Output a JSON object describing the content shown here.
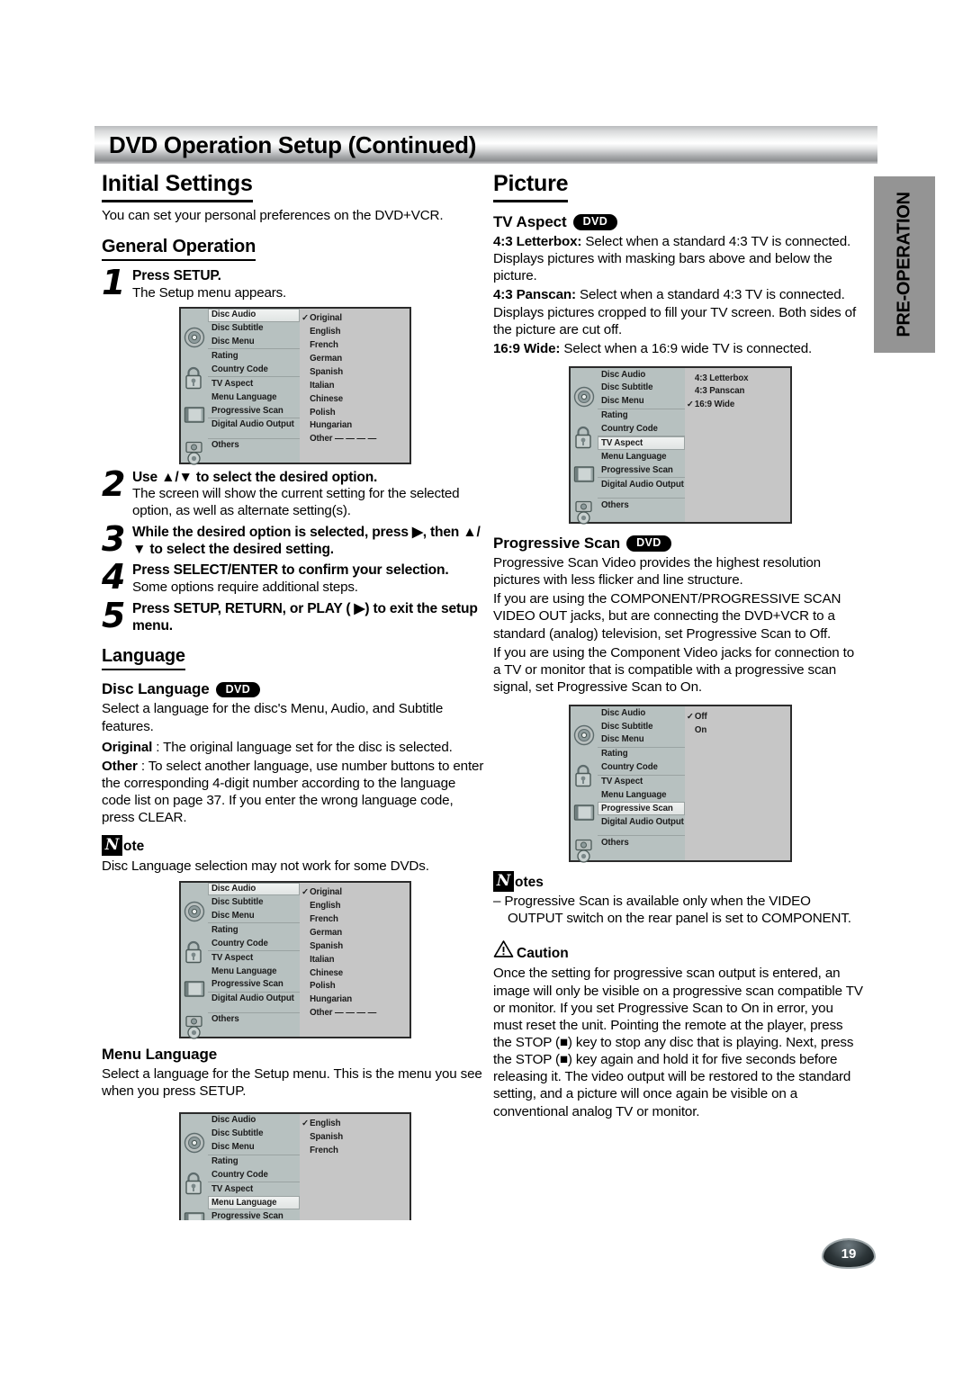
{
  "header": {
    "title": "DVD Operation Setup (Continued)"
  },
  "side_tab": {
    "label": "PRE-OPERATION"
  },
  "page_number": "19",
  "left_column": {
    "initial_settings": {
      "heading": "Initial Settings",
      "intro": "You can set your personal preferences on the DVD+VCR."
    },
    "general_operation": {
      "heading": "General Operation",
      "steps": [
        {
          "num": "1",
          "bold": "Press SETUP.",
          "text": "The Setup menu appears."
        },
        {
          "num": "2",
          "bold": "Use ▲/▼ to select the desired option.",
          "text": "The screen will show the current setting for the selected option, as well as alternate setting(s)."
        },
        {
          "num": "3",
          "bold": "While the desired option is selected, press ▶, then ▲/▼ to select the desired setting.",
          "text": ""
        },
        {
          "num": "4",
          "bold": "Press SELECT/ENTER to confirm your selection.",
          "text": "Some options require additional steps."
        },
        {
          "num": "5",
          "bold": "Press SETUP, RETURN, or PLAY ( ▶) to exit the setup menu.",
          "text": ""
        }
      ]
    },
    "language": {
      "heading": "Language",
      "disc_language": {
        "title": "Disc Language",
        "badge": "DVD",
        "para1": "Select a language for the disc's Menu, Audio, and Subtitle features.",
        "original_label": "Original",
        "original_text": " : The original language set for the disc is selected.",
        "other_label": "Other",
        "other_text": " : To select another language, use number buttons to enter the corresponding 4-digit number according to the language code list on page 37. If you enter the wrong language code, press CLEAR.",
        "note_glyph": "N",
        "note_word": "ote",
        "note_text": "Disc Language selection may not work for some DVDs."
      },
      "menu_language": {
        "title": "Menu Language",
        "para": "Select a language for the Setup menu. This is the menu you see when you press SETUP."
      }
    }
  },
  "right_column": {
    "picture": {
      "heading": "Picture",
      "tv_aspect": {
        "title": "TV Aspect",
        "badge": "DVD",
        "letterbox_label": "4:3 Letterbox:",
        "letterbox_text": " Select when a standard 4:3 TV is connected. Displays pictures with masking bars above and below the picture.",
        "panscan_label": "4:3 Panscan:",
        "panscan_text": " Select when a standard 4:3 TV is connected. Displays pictures cropped to fill your TV screen. Both sides of the picture are cut off.",
        "wide_label": "16:9 Wide:",
        "wide_text": " Select when a 16:9 wide TV is connected."
      },
      "progressive_scan": {
        "title": "Progressive Scan",
        "badge": "DVD",
        "para1": "Progressive Scan Video provides the highest resolution pictures with less flicker and line structure.",
        "para2": "If you are using the COMPONENT/PROGRESSIVE SCAN VIDEO OUT jacks, but are connecting the DVD+VCR to a standard (analog) television, set Progressive Scan to Off.",
        "para3": "If you are using the Component Video jacks for connection to a TV or monitor that is compatible with a progressive scan signal, set Progressive Scan to On."
      },
      "notes": {
        "glyph": "N",
        "word": "otes",
        "item1": "– Progressive Scan is available only when the VIDEO OUTPUT switch on the rear panel is set to COMPONENT."
      },
      "caution": {
        "word": "Caution",
        "text": "Once the setting for progressive scan output is entered, an image will only be visible on a progressive scan compatible TV or monitor. If you set Progressive Scan to On in error, you must reset the unit. Pointing the remote at the player, press the STOP (■) key to stop any disc that is playing. Next, press the STOP (■) key again and hold it for five seconds before releasing it. The video output will be restored to the standard setting, and a picture will once again be visible on a conventional analog TV or monitor."
      }
    }
  },
  "osd_menus": {
    "labels": {
      "disc_audio": "Disc Audio",
      "disc_subtitle": "Disc Subtitle",
      "disc_menu": "Disc Menu",
      "rating": "Rating",
      "country_code": "Country Code",
      "tv_aspect": "TV Aspect",
      "menu_language": "Menu Language",
      "progressive_scan": "Progressive Scan",
      "digital_audio_output": "Digital Audio Output",
      "others": "Others"
    },
    "language_options": [
      "Original",
      "English",
      "French",
      "German",
      "Spanish",
      "Italian",
      "Chinese",
      "Polish",
      "Hungarian",
      "Other — — — —"
    ],
    "language_selected": "Original",
    "tv_aspect_options": [
      "4:3 Letterbox",
      "4:3 Panscan",
      "16:9 Wide"
    ],
    "tv_aspect_selected": "16:9 Wide",
    "progressive_options": [
      "Off",
      "On"
    ],
    "progressive_selected": "Off",
    "menu_language_options": [
      "English",
      "Spanish",
      "French"
    ],
    "menu_language_selected": "English"
  }
}
